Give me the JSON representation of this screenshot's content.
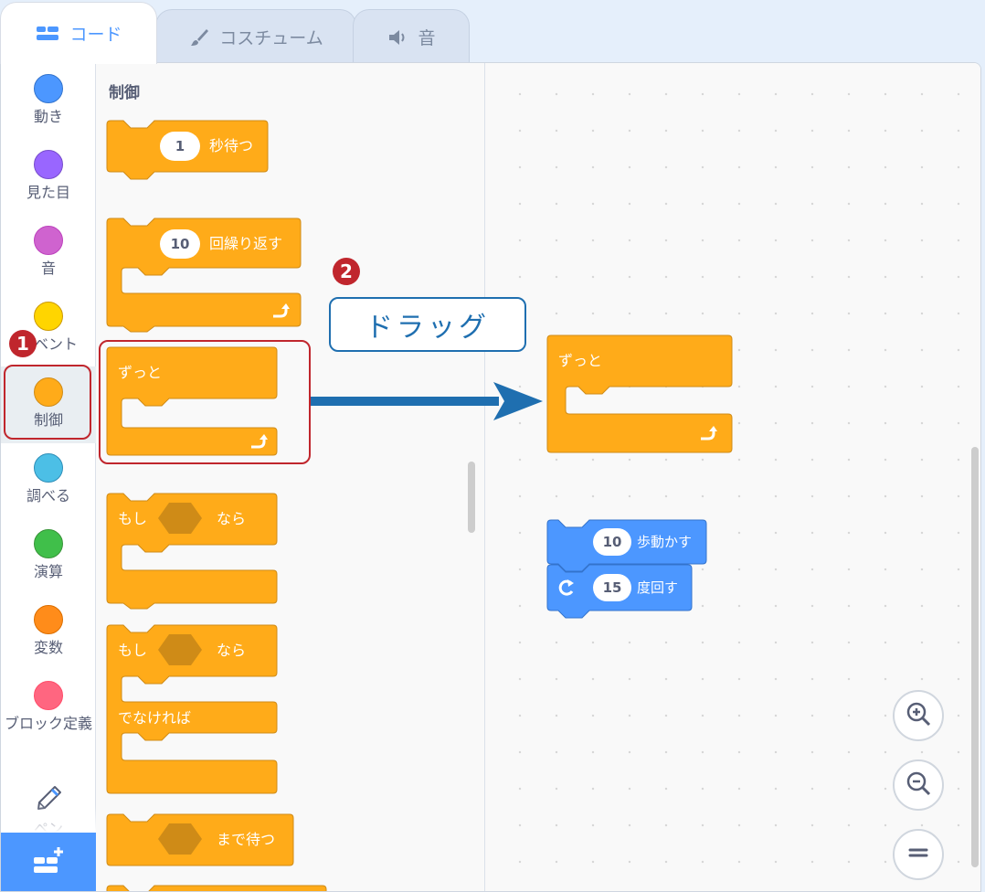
{
  "tabs": [
    {
      "label": "コード",
      "icon": "code-icon",
      "active": true
    },
    {
      "label": "コスチューム",
      "icon": "brush-icon",
      "active": false
    },
    {
      "label": "音",
      "icon": "speaker-icon",
      "active": false
    }
  ],
  "categories": [
    {
      "label": "動き",
      "color": "#4c97ff"
    },
    {
      "label": "見た目",
      "color": "#9966ff"
    },
    {
      "label": "音",
      "color": "#cf63cf"
    },
    {
      "label": "イベント",
      "color": "#ffd500"
    },
    {
      "label": "制御",
      "color": "#ffab19",
      "selected": true
    },
    {
      "label": "調べる",
      "color": "#4cbfe6"
    },
    {
      "label": "演算",
      "color": "#40bf4a"
    },
    {
      "label": "変数",
      "color": "#ff8c1a"
    },
    {
      "label": "ブロック定義",
      "color": "#ff6680"
    },
    {
      "label": "ペン",
      "icon": "pen-icon"
    }
  ],
  "palette": {
    "title": "制御",
    "blocks": {
      "wait": {
        "value": "1",
        "text": "秒待つ"
      },
      "repeat": {
        "value": "10",
        "text": "回繰り返す"
      },
      "forever": {
        "text": "ずっと"
      },
      "if_then": {
        "left": "もし",
        "right": "なら"
      },
      "if_else": {
        "left": "もし",
        "right": "なら",
        "else": "でなければ"
      },
      "wait_until": {
        "text": "まで待つ"
      }
    }
  },
  "workspace": {
    "forever": {
      "text": "ずっと"
    },
    "move": {
      "value": "10",
      "text": "歩動かす"
    },
    "turn": {
      "value": "15",
      "text": "度回す"
    }
  },
  "annotations": {
    "badge1": "1",
    "badge2": "2",
    "drag_label": "ドラッグ"
  },
  "colors": {
    "control": "#ffab19",
    "control_dark": "#cf8b17",
    "motion": "#4c97ff",
    "annotation_red": "#c0262d",
    "annotation_blue": "#1f6fb0"
  }
}
